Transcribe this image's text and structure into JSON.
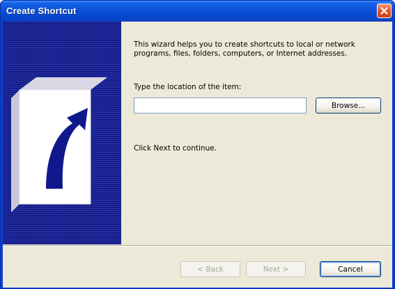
{
  "window": {
    "title": "Create Shortcut"
  },
  "banner": {
    "icon": "shortcut-arrow-icon"
  },
  "wizard": {
    "intro": "This wizard helps you to create shortcuts to local or network programs, files, folders, computers, or Internet addresses.",
    "location_label": "Type the location of the item:",
    "location_value": "",
    "browse_label": "Browse...",
    "continue_text": "Click Next to continue."
  },
  "buttons": {
    "back_label": "< Back",
    "next_label": "Next >",
    "cancel_label": "Cancel"
  },
  "colors": {
    "title_bar": "#0a52d8",
    "banner_bg": "#10188c",
    "client_bg": "#ece9d8",
    "close_button": "#e0522a"
  }
}
